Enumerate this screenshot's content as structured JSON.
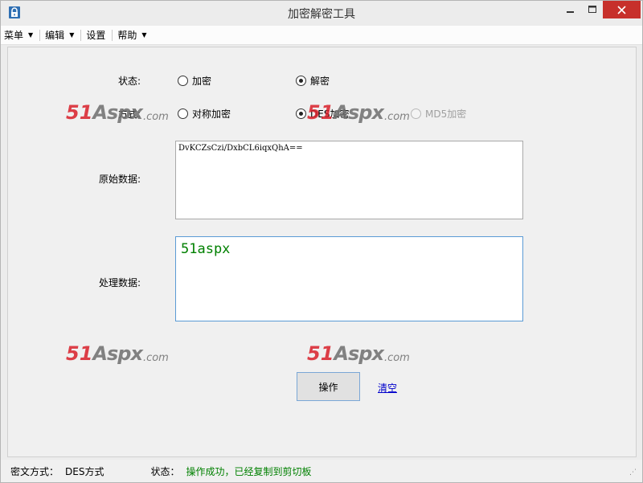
{
  "window": {
    "title": "加密解密工具"
  },
  "menu": [
    {
      "label": "菜单",
      "has_dropdown": true
    },
    {
      "label": "编辑",
      "has_dropdown": true
    },
    {
      "label": "设置",
      "has_dropdown": false
    },
    {
      "label": "帮助",
      "has_dropdown": true
    }
  ],
  "form": {
    "state_label": "状态:",
    "state_options": [
      {
        "label": "加密",
        "checked": false
      },
      {
        "label": "解密",
        "checked": true
      }
    ],
    "mode_label": "方式:",
    "mode_options": [
      {
        "label": "对称加密",
        "checked": false,
        "disabled": false
      },
      {
        "label": "DES加密",
        "checked": true,
        "disabled": false
      },
      {
        "label": "MD5加密",
        "checked": false,
        "disabled": true
      }
    ],
    "source_label": "原始数据:",
    "source_value": "DvKCZsCzi/DxbCL6iqxQhA==",
    "result_label": "处理数据:",
    "result_value": "51aspx",
    "run_button": "操作",
    "clear_link": "清空"
  },
  "watermark": {
    "part1": "51",
    "part2": "Aspx",
    "part3": ".com"
  },
  "status": {
    "mode_label": "密文方式：",
    "mode_value": "DES方式",
    "state_label": "状态：",
    "state_value": "操作成功，已经复制到剪切板"
  },
  "colors": {
    "close_button": "#c7302b",
    "success_text": "#008000",
    "link": "#0000cc",
    "watermark_red": "#d9202a"
  }
}
